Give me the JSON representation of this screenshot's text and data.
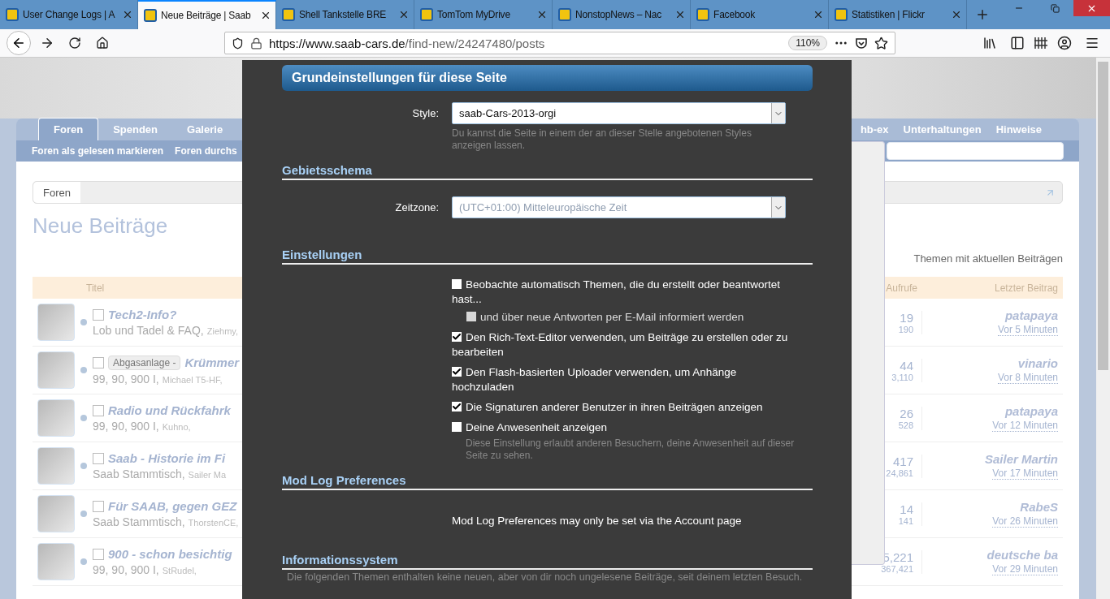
{
  "browser": {
    "tabs": [
      {
        "title": "User Change Logs | A",
        "selected": false
      },
      {
        "title": "Neue Beiträge | Saab",
        "selected": true
      },
      {
        "title": "Shell Tankstelle BRE",
        "selected": false
      },
      {
        "title": "TomTom MyDrive",
        "selected": false
      },
      {
        "title": "NonstopNews – Nac",
        "selected": false
      },
      {
        "title": "Facebook",
        "selected": false
      },
      {
        "title": "Statistiken | Flickr",
        "selected": false
      }
    ],
    "url_host": "https://www.saab-cars.de",
    "url_path": "/find-new/24247480/posts",
    "zoom": "110%"
  },
  "site": {
    "nav_tabs": [
      {
        "label": "Foren",
        "selected": true
      },
      {
        "label": "Spenden",
        "selected": false
      },
      {
        "label": "Galerie",
        "selected": false
      }
    ],
    "nav_tabs_right": [
      {
        "label": "hb-ex",
        "selected": false
      },
      {
        "label": "Unterhaltungen",
        "selected": false
      },
      {
        "label": "Hinweise",
        "selected": false
      }
    ],
    "subnav": [
      "Foren als gelesen markieren",
      "Foren durchs"
    ],
    "breadcrumb": [
      "Foren"
    ],
    "page_title": "Neue Beiträge",
    "filter_link": "Themen mit aktuellen Beiträgen",
    "table": {
      "columns": [
        "Titel",
        "Aufrufe",
        "Letzter Beitrag"
      ],
      "rows": [
        {
          "selected": false,
          "title": "Tech2-Info?",
          "forum": "Lob und Tadel & FAQ,",
          "author": "Ziehmy,",
          "replies": "19",
          "views": "190",
          "last_user": "patapaya",
          "last_time": "Vor 5 Minuten"
        },
        {
          "selected": false,
          "prefix": "Abgasanlage -",
          "title": "Krümmer",
          "forum": "99, 90, 900 I,",
          "author": "Michael T5-HF,",
          "replies": "44",
          "views": "3,110",
          "last_user": "vinario",
          "last_time": "Vor 8 Minuten"
        },
        {
          "selected": false,
          "title": "Radio und Rückfahrk",
          "forum": "99, 90, 900 I,",
          "author": "Kuhno,",
          "replies": "26",
          "views": "528",
          "last_user": "patapaya",
          "last_time": "Vor 12 Minuten"
        },
        {
          "selected": false,
          "title": "Saab - Historie im Fi",
          "forum": "Saab Stammtisch,",
          "author": "Sailer Ma",
          "replies": "417",
          "views": "24,861",
          "last_user": "Sailer Martin",
          "last_time": "Vor 17 Minuten"
        },
        {
          "selected": false,
          "title": "Für SAAB, gegen GEZ",
          "forum": "Saab Stammtisch,",
          "author": "ThorstenCE,",
          "replies": "14",
          "views": "141",
          "last_user": "RabeS",
          "last_time": "Vor 26 Minuten"
        },
        {
          "selected": false,
          "title": "900 - schon besichtig",
          "forum": "99, 90, 900 I,",
          "author": "StRudel,",
          "replies": "5,221",
          "views": "367,421",
          "last_user": "deutsche ba",
          "last_time": "Vor 29 Minuten"
        }
      ]
    }
  },
  "dialog": {
    "title": "Grundeinstellungen für diese Seite",
    "style": {
      "label": "Style:",
      "value": "saab-Cars-2013-orgi",
      "hint": "Du kannst die Seite in einem der an dieser Stelle angebotenen Styles anzeigen lassen."
    },
    "locale": {
      "heading": "Gebietsschema",
      "label": "Zeitzone:",
      "value": "(UTC+01:00) Mitteleuropäische Zeit",
      "disabled": true
    },
    "settings": {
      "heading": "Einstellungen",
      "options": [
        {
          "label": "Beobachte automatisch Themen, die du erstellt oder beantwortet hast...",
          "checked": false,
          "disabled": false,
          "children": [
            {
              "label": "und über neue Antworten per E-Mail informiert werden",
              "checked": false,
              "disabled": true
            }
          ]
        },
        {
          "label": "Den Rich-Text-Editor verwenden, um Beiträge zu erstellen oder zu bearbeiten",
          "checked": true,
          "disabled": false
        },
        {
          "label": "Den Flash-basierten Uploader verwenden, um Anhänge hochzuladen",
          "checked": true,
          "disabled": false
        },
        {
          "label": "Die Signaturen anderer Benutzer in ihren Beiträgen anzeigen",
          "checked": true,
          "disabled": false
        },
        {
          "label": "Deine Anwesenheit anzeigen",
          "checked": false,
          "disabled": false,
          "hint": "Diese Einstellung erlaubt anderen Besuchern, deine Anwesenheit auf dieser Seite zu sehen."
        }
      ]
    },
    "mod_log": {
      "heading": "Mod Log Preferences",
      "text": "Mod Log Preferences may only be set via the Account page"
    },
    "info": {
      "heading": "Informationssystem",
      "text": "Die folgenden Themen enthalten keine neuen, aber von dir noch ungelesene Beiträge, seit deinem letzten Besuch."
    }
  }
}
